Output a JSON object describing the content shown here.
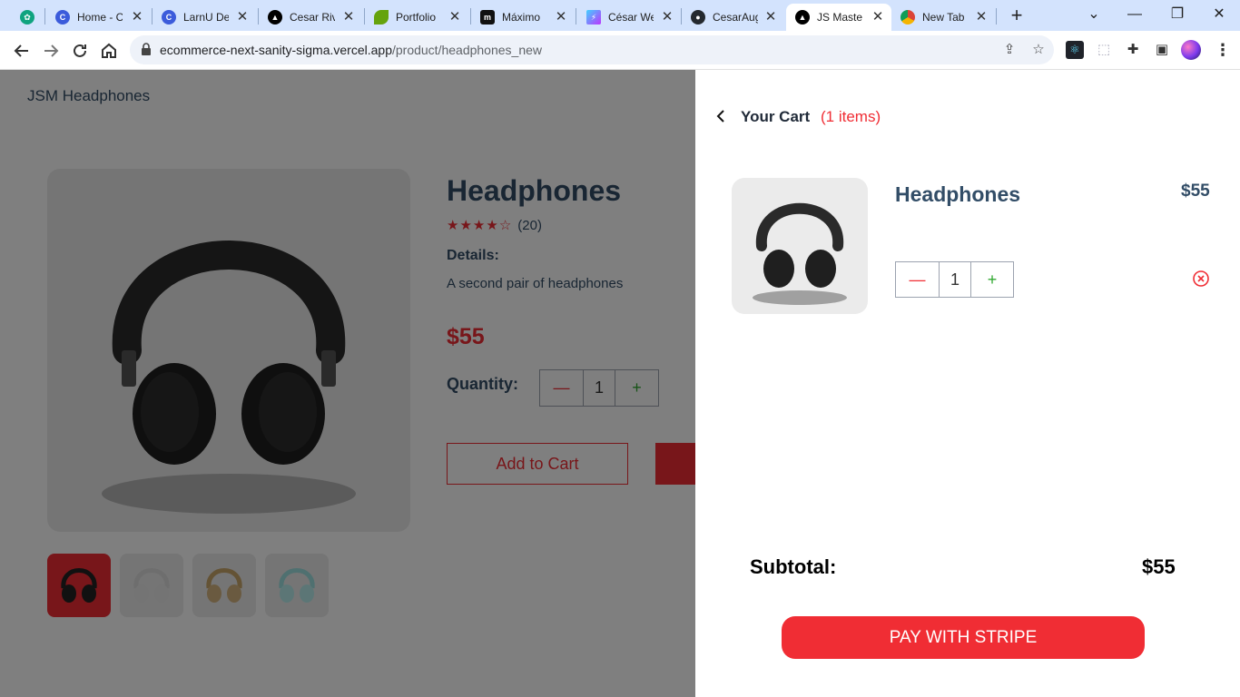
{
  "browser": {
    "tabs": [
      {
        "title": "",
        "color": "#10a37f"
      },
      {
        "title": "Home - C",
        "color": "#3b5bdb"
      },
      {
        "title": "LarnU De",
        "color": "#3b5bdb"
      },
      {
        "title": "Cesar Riv",
        "color": "#000000"
      },
      {
        "title": "Portfolio",
        "color": "#65a30d"
      },
      {
        "title": "Máximo",
        "color": "#111111"
      },
      {
        "title": "César We",
        "color": "#a855f7"
      },
      {
        "title": "CesarAug",
        "color": "#24292f"
      },
      {
        "title": "JS Maste",
        "color": "#000000"
      },
      {
        "title": "New Tab",
        "color": "#5f6368"
      }
    ],
    "active_tab_index": 8,
    "url_host": "ecommerce-next-sanity-sigma.vercel.app",
    "url_path": "/product/headphones_new"
  },
  "page": {
    "brand": "JSM Headphones",
    "product": {
      "name": "Headphones",
      "rating": 4,
      "rating_max": 5,
      "review_count": "(20)",
      "details_label": "Details:",
      "details_text": "A second pair of headphones",
      "price": "$55",
      "quantity_label": "Quantity:",
      "quantity": "1",
      "add_to_cart_label": "Add to Cart",
      "selected_thumbnail": 0
    }
  },
  "cart": {
    "heading": "Your Cart",
    "count": "(1 items)",
    "items": [
      {
        "name": "Headphones",
        "price": "$55",
        "quantity": "1"
      }
    ],
    "subtotal_label": "Subtotal:",
    "subtotal_value": "$55",
    "pay_label": "PAY WITH STRIPE"
  },
  "colors": {
    "accent": "#f02d34",
    "text_dark": "#324d67",
    "plus_green": "#31a831"
  }
}
